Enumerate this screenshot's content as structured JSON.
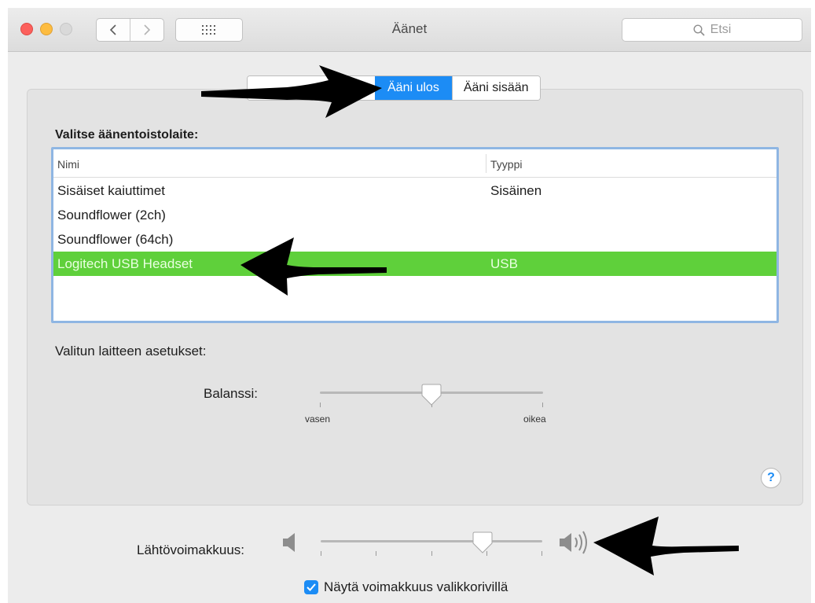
{
  "window": {
    "title": "Äänet",
    "search_placeholder": "Etsi"
  },
  "icons": {
    "back": "chevron-left-icon",
    "forward": "chevron-right-icon",
    "show_all": "grid-icon",
    "search": "search-icon",
    "help": "help-icon",
    "speaker_low": "speaker-low-icon",
    "speaker_high": "speaker-high-icon"
  },
  "tabs": [
    {
      "label": "",
      "active": false
    },
    {
      "label": "Ääni ulos",
      "active": true
    },
    {
      "label": "Ääni sisään",
      "active": false
    }
  ],
  "output": {
    "choose_label": "Valitse äänentoistolaite:",
    "columns": {
      "name": "Nimi",
      "type": "Tyyppi"
    },
    "devices": [
      {
        "name": "Sisäiset kaiuttimet",
        "type": "Sisäinen",
        "selected": false
      },
      {
        "name": "Soundflower (2ch)",
        "type": "",
        "selected": false
      },
      {
        "name": "Soundflower (64ch)",
        "type": "",
        "selected": false
      },
      {
        "name": "Logitech USB Headset",
        "type": "USB",
        "selected": true
      }
    ],
    "settings_label": "Valitun laitteen asetukset:",
    "balance": {
      "label": "Balanssi:",
      "left": "vasen",
      "right": "oikea",
      "value": 0.5
    },
    "help": "?"
  },
  "volume": {
    "label": "Lähtövoimakkuus:",
    "value": 0.73,
    "show_in_menubar_label": "Näytä voimakkuus valikkorivillä",
    "show_in_menubar": true
  },
  "colors": {
    "accent": "#1c8cf5",
    "selection": "#5fd03b"
  }
}
